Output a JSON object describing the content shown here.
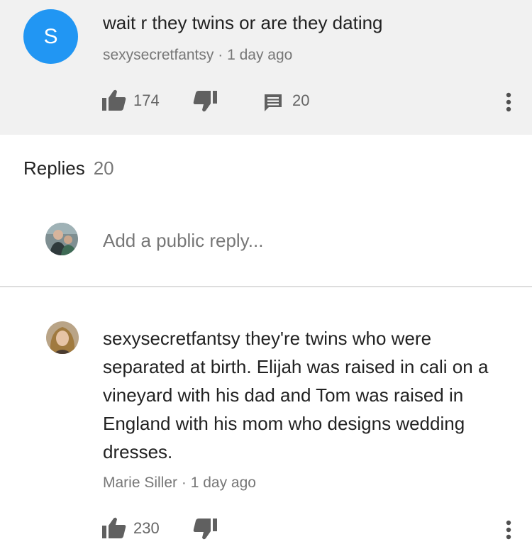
{
  "top_comment": {
    "avatar_letter": "S",
    "text": "wait r they twins or are they dating",
    "author": "sexysecretfantsy",
    "time": "1 day ago",
    "likes": "174",
    "reply_count": "20"
  },
  "replies_header": {
    "label": "Replies",
    "count": "20"
  },
  "reply_input": {
    "placeholder": "Add a public reply..."
  },
  "replies": [
    {
      "text": "sexysecretfantsy they're twins who were separated at birth. Elijah was raised in cali on a vineyard with his dad and Tom was raised in England with his mom who designs wedding dresses.",
      "author": "Marie Siller",
      "time": "1 day ago",
      "likes": "230"
    }
  ],
  "meta_separator": " · ",
  "icons": {
    "like": "thumb-up-icon",
    "dislike": "thumb-down-icon",
    "comment": "comment-icon",
    "more": "more-vertical-icon",
    "user_avatar": "user-avatar-icon"
  },
  "colors": {
    "avatar_blue": "#2196f3",
    "top_bg": "#f1f1f1",
    "icon_gray": "#606060",
    "meta_text": "#777777"
  }
}
